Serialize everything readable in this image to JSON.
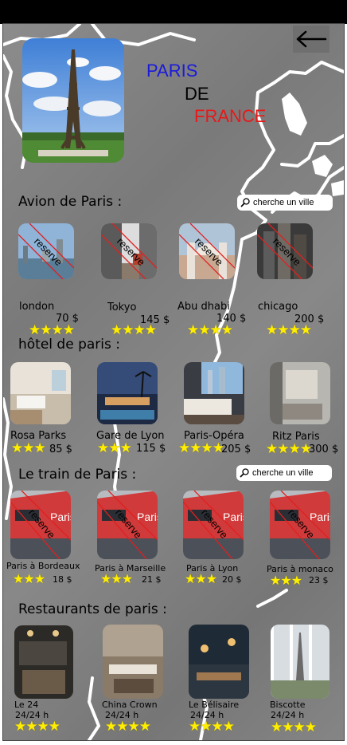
{
  "header": {
    "line1": "PARIS",
    "line2": "DE",
    "line3": "FRANCE"
  },
  "colors": {
    "paris": "#1a1adb",
    "de": "#000000",
    "france": "#e81818",
    "star": "#ffee00",
    "reserve_line": "#e02020"
  },
  "icons": {
    "back": "arrow-left-icon",
    "search": "magnifier-icon",
    "hero": "eiffel-tower-photo"
  },
  "search": {
    "placeholder": "cherche un ville"
  },
  "flights": {
    "title": "Avion de Paris  :",
    "stamp": "reserve",
    "items": [
      {
        "name": "london",
        "price": "70 $",
        "stars": "★★★★"
      },
      {
        "name": "Tokyo",
        "price": "145 $",
        "stars": "★★★★"
      },
      {
        "name": "Abu dhabi",
        "price": "140 $",
        "stars": "★★★★"
      },
      {
        "name": "chicago",
        "price": "200 $",
        "stars": "★★★★"
      }
    ]
  },
  "hotels": {
    "title": "hôtel de paris :",
    "items": [
      {
        "name": "Rosa Parks",
        "price": "85 $",
        "stars": "★★★"
      },
      {
        "name": "Gare de Lyon",
        "price": "115 $",
        "stars": "★★★"
      },
      {
        "name": "Paris-Opéra",
        "price": "205 $",
        "stars": "★★★★"
      },
      {
        "name": "Ritz Paris",
        "price": "300 $",
        "stars": "★★★★"
      }
    ]
  },
  "trains": {
    "title": "Le train de Paris :",
    "stamp": "reserve",
    "image_label": "Paris",
    "items": [
      {
        "name": "Paris à Bordeaux",
        "price": "18 $",
        "stars": "★★★"
      },
      {
        "name": "Paris à Marseille",
        "price": "21 $",
        "stars": "★★★"
      },
      {
        "name": "Paris à Lyon",
        "price": "20 $",
        "stars": "★★★"
      },
      {
        "name": "Paris à monaco",
        "price": "23 $",
        "stars": "★★★"
      }
    ]
  },
  "restaurants": {
    "title": "Restaurants de paris :",
    "items": [
      {
        "name": "Le 24",
        "hours": "24/24 h",
        "stars": "★★★★"
      },
      {
        "name": "China Crown",
        "hours": "24/24 h",
        "stars": "★★★★"
      },
      {
        "name": "Le Bélisaire",
        "hours": "24/24 h",
        "stars": "★★★★"
      },
      {
        "name": "Biscotte",
        "hours": "24/24 h",
        "stars": "★★★★"
      }
    ]
  }
}
